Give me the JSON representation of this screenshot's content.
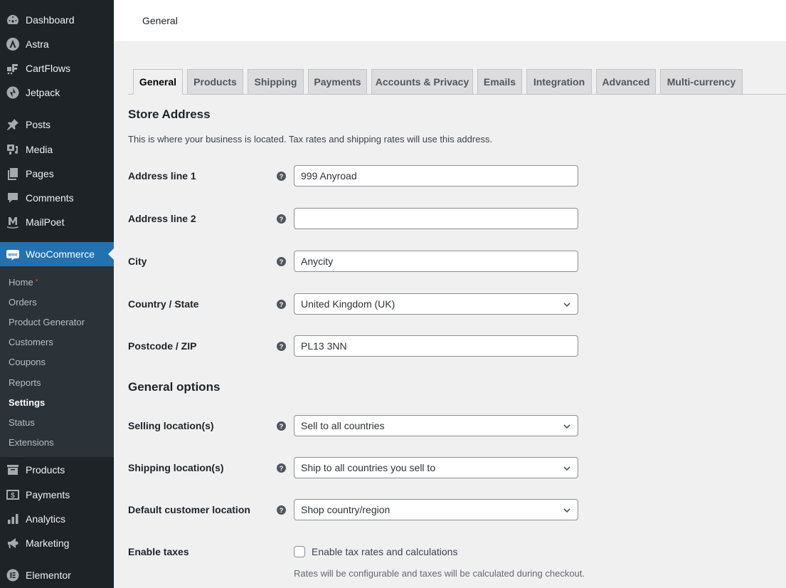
{
  "sidebar": {
    "items": [
      {
        "label": "Dashboard",
        "icon": "dashboard-icon"
      },
      {
        "label": "Astra",
        "icon": "astra-icon"
      },
      {
        "label": "CartFlows",
        "icon": "cartflows-icon"
      },
      {
        "label": "Jetpack",
        "icon": "jetpack-icon"
      },
      {
        "label": "Posts",
        "icon": "pin-icon"
      },
      {
        "label": "Media",
        "icon": "media-icon"
      },
      {
        "label": "Pages",
        "icon": "pages-icon"
      },
      {
        "label": "Comments",
        "icon": "comment-icon"
      },
      {
        "label": "MailPoet",
        "icon": "mailpoet-icon"
      },
      {
        "label": "WooCommerce",
        "icon": "woo-icon",
        "active": true
      },
      {
        "label": "Products",
        "icon": "archive-icon"
      },
      {
        "label": "Payments",
        "icon": "dollar-icon"
      },
      {
        "label": "Analytics",
        "icon": "bar-chart-icon"
      },
      {
        "label": "Marketing",
        "icon": "megaphone-icon"
      },
      {
        "label": "Elementor",
        "icon": "elementor-icon"
      }
    ],
    "submenu": [
      {
        "label": "Home",
        "badge": "•"
      },
      {
        "label": "Orders"
      },
      {
        "label": "Product Generator"
      },
      {
        "label": "Customers"
      },
      {
        "label": "Coupons"
      },
      {
        "label": "Reports"
      },
      {
        "label": "Settings",
        "current": true
      },
      {
        "label": "Status"
      },
      {
        "label": "Extensions"
      }
    ]
  },
  "header": {
    "title": "General"
  },
  "tabs": [
    {
      "label": "General",
      "active": true
    },
    {
      "label": "Products"
    },
    {
      "label": "Shipping"
    },
    {
      "label": "Payments"
    },
    {
      "label": "Accounts & Privacy"
    },
    {
      "label": "Emails"
    },
    {
      "label": "Integration"
    },
    {
      "label": "Advanced"
    },
    {
      "label": "Multi-currency"
    }
  ],
  "store_address": {
    "heading": "Store Address",
    "description": "This is where your business is located. Tax rates and shipping rates will use this address.",
    "fields": [
      {
        "label": "Address line 1",
        "value": "999 Anyroad",
        "type": "text"
      },
      {
        "label": "Address line 2",
        "value": "",
        "type": "text"
      },
      {
        "label": "City",
        "value": "Anycity",
        "type": "text"
      },
      {
        "label": "Country / State",
        "value": "United Kingdom (UK)",
        "type": "select"
      },
      {
        "label": "Postcode / ZIP",
        "value": "PL13 3NN",
        "type": "text"
      }
    ]
  },
  "general_options": {
    "heading": "General options",
    "fields": [
      {
        "label": "Selling location(s)",
        "value": "Sell to all countries",
        "type": "select"
      },
      {
        "label": "Shipping location(s)",
        "value": "Ship to all countries you sell to",
        "type": "select"
      },
      {
        "label": "Default customer location",
        "value": "Shop country/region",
        "type": "select"
      }
    ],
    "taxes": {
      "label": "Enable taxes",
      "checkbox_label": "Enable tax rates and calculations",
      "checked": false,
      "note": "Rates will be configurable and taxes will be calculated during checkout."
    }
  },
  "help_glyph": "?",
  "colors": {
    "accent": "#2271b1",
    "sidebar": "#1d2327",
    "submenu": "#2c3338"
  }
}
